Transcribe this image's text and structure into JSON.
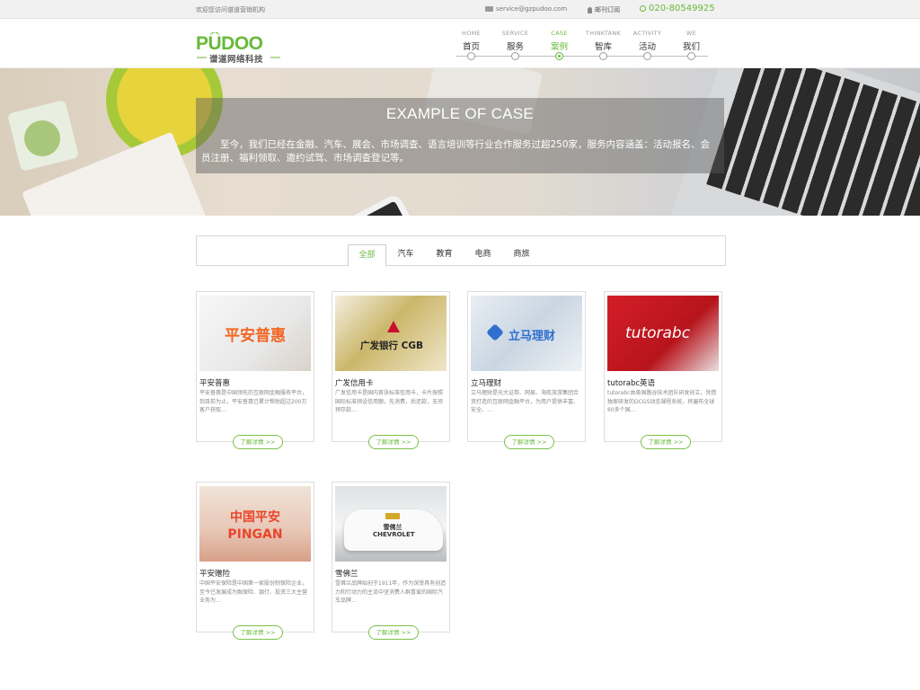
{
  "topbar": {
    "welcome": "欢迎您访问谱道营销机构",
    "email": "service@gzpudoo.com",
    "subscribe": "邮刊订阅",
    "phone": "020-80549925"
  },
  "logo": {
    "name": "PUDOO",
    "tagline": "谱道网络科技"
  },
  "nav": [
    {
      "en": "HOME",
      "cn": "首页"
    },
    {
      "en": "SERVICE",
      "cn": "服务"
    },
    {
      "en": "CASE",
      "cn": "案例"
    },
    {
      "en": "THINKTANK",
      "cn": "智库"
    },
    {
      "en": "ACTIVITY",
      "cn": "活动"
    },
    {
      "en": "WE",
      "cn": "我们"
    }
  ],
  "banner": {
    "title": "EXAMPLE OF CASE",
    "desc": "至今，我们已经在金融、汽车、展会、市场调查、语言培训等行业合作服务过超250家，服务内容涵盖：活动报名、会员注册、福利领取、邀约试驾、市场调查登记等。"
  },
  "filters": [
    "全部",
    "汽车",
    "教育",
    "电商",
    "商旅"
  ],
  "cards": [
    {
      "title": "平安普惠",
      "desc": "平安普惠是中国领先的互联网金融服务平台，到目前为止，平安普惠已累计帮助超过200万客户获取…",
      "more": "了解详情 >>",
      "thumb_text": "平安普惠"
    },
    {
      "title": "广发信用卡",
      "desc": "广发信用卡是国内首张标准信用卡，卡片按照国际标准预设信用额，先消费，后还款，无须预存款…",
      "more": "了解详情 >>",
      "thumb_text": "广发银行 CGB"
    },
    {
      "title": "立马理财",
      "desc": "立马理财是光大证券、网易、海航旅游集团合资打造的互联网金融平台，为用户提供丰富、安全、…",
      "more": "了解详情 >>",
      "thumb_text": "立马理财"
    },
    {
      "title": "tutorabc英语",
      "desc": "tutorabc由美国路谷技术团队研发创立，凭借独家研发的DCGS动态课程系统，将遍布全球60多个国…",
      "more": "了解详情 >>",
      "thumb_text": "tutorabc"
    },
    {
      "title": "平安赠险",
      "desc": "中国平安保险是中国第一家股份制保险企业，至今已发展成为融保险、银行、投资三大主营业务为…",
      "more": "了解详情 >>",
      "thumb_text": "中国平安 PINGAN"
    },
    {
      "title": "雪佛兰",
      "desc": "雪佛兰品牌始创于1911年，作为深受具有创造力和行动力的主流中坚消费人群喜爱的国际汽车品牌…",
      "more": "了解详情 >>",
      "thumb_text": "雪佛兰 CHEVROLET"
    }
  ],
  "colors": {
    "accent": "#69b93a"
  }
}
